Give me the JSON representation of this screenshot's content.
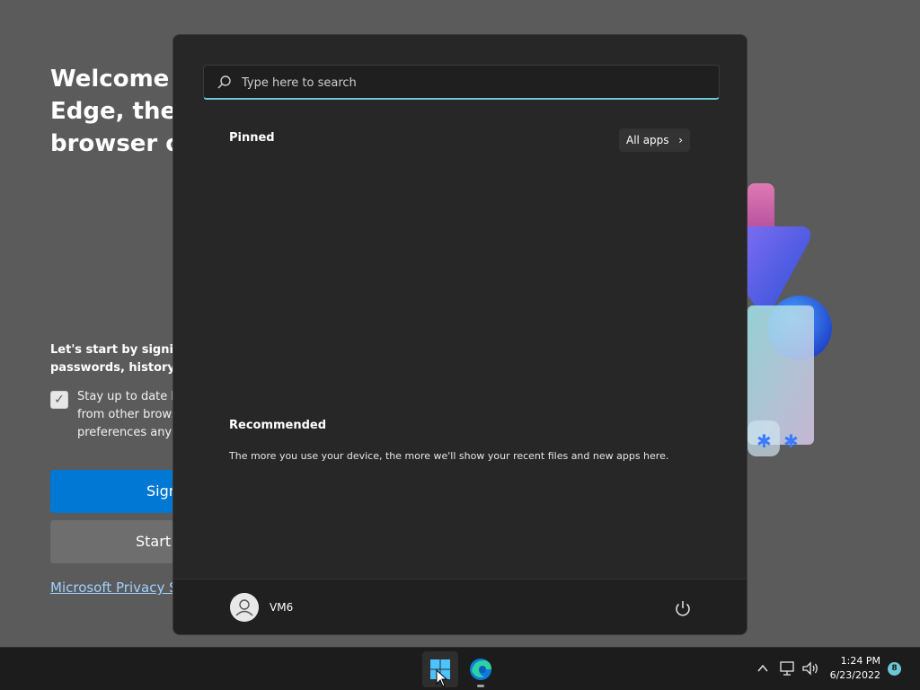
{
  "background_page": {
    "welcome_lines": [
      "Welcome t",
      "Edge, the b",
      "browser or"
    ],
    "lets_start_lines": [
      "Let's start by signing",
      "passwords, history, a"
    ],
    "stay_lines": [
      "Stay up to date b",
      "from other brows",
      "preferences any t"
    ],
    "checkbox_checked": true,
    "signin_label": "Sign",
    "start_without_label": "Start w",
    "privacy_link": "Microsoft Privacy St"
  },
  "start_menu": {
    "search_placeholder": "Type here to search",
    "pinned_label": "Pinned",
    "all_apps_label": "All apps",
    "recommended_label": "Recommended",
    "recommended_text": "The more you use your device, the more we'll show your recent files and new apps here.",
    "user_name": "VM6"
  },
  "taskbar": {
    "time": "1:24 PM",
    "date": "6/23/2022",
    "notification_count": "8",
    "icons": [
      "start-icon",
      "edge-icon",
      "chevron-up-icon",
      "network-icon",
      "volume-icon"
    ]
  },
  "colors": {
    "accent": "#6cc6d6",
    "edge_blue": "#0078d4",
    "menu_bg": "#272727",
    "taskbar_bg": "#1c1c1c"
  }
}
